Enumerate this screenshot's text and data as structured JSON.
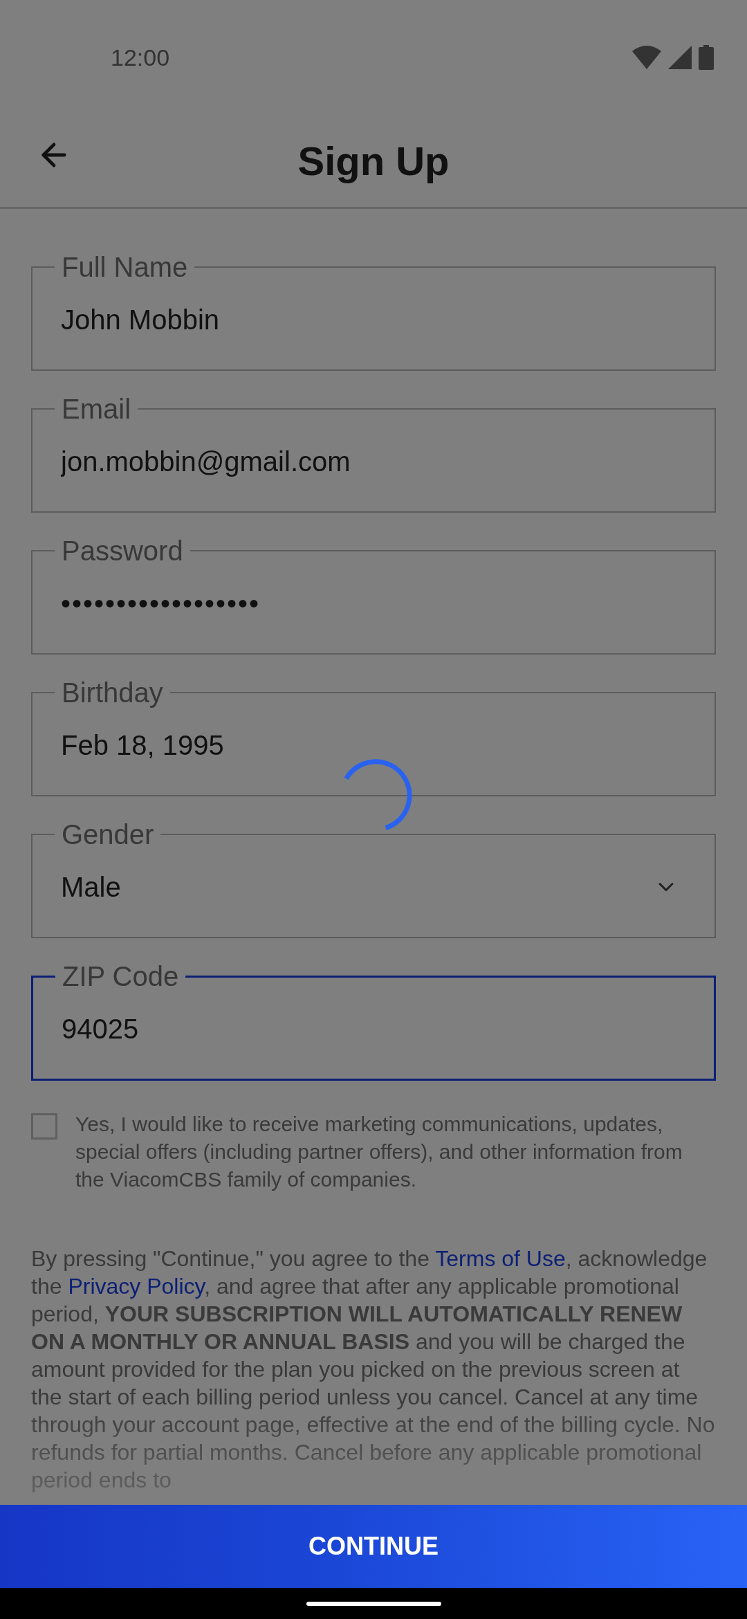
{
  "status_bar": {
    "time": "12:00"
  },
  "app_bar": {
    "title": "Sign Up"
  },
  "fields": [
    {
      "kind": "text",
      "label": "Full Name",
      "value": "John Mobbin",
      "focused": false
    },
    {
      "kind": "text",
      "label": "Email",
      "value": "jon.mobbin@gmail.com",
      "focused": false
    },
    {
      "kind": "password",
      "label": "Password",
      "value": "••••••••••••••••••",
      "focused": false
    },
    {
      "kind": "text",
      "label": "Birthday",
      "value": "Feb 18, 1995",
      "focused": false
    },
    {
      "kind": "dropdown",
      "label": "Gender",
      "value": "Male",
      "focused": false
    },
    {
      "kind": "text",
      "label": "ZIP Code",
      "value": "94025",
      "focused": true
    }
  ],
  "marketing_opt_in": {
    "checked": false,
    "label": "Yes, I would like to receive marketing communications, updates, special offers (including partner offers), and other information from the ViacomCBS family of companies."
  },
  "legal": [
    {
      "kind": "plain",
      "text": "By pressing \"Continue,\" you agree to the "
    },
    {
      "kind": "link",
      "text": "Terms of Use"
    },
    {
      "kind": "plain",
      "text": ", acknowledge the "
    },
    {
      "kind": "link",
      "text": "Privacy Policy"
    },
    {
      "kind": "plain",
      "text": ", and agree that after any applicable promotional period, "
    },
    {
      "kind": "bold",
      "text": "YOUR SUBSCRIPTION WILL AUTOMATICALLY RENEW ON A MONTHLY OR ANNUAL BASIS"
    },
    {
      "kind": "plain",
      "text": " and you will be charged the amount provided for the plan you picked on the previous screen at the start of each billing period unless you cancel. Cancel at any time through your account page, effective at the end of the billing cycle. No refunds for partial months. Cancel before any applicable promotional period ends to"
    }
  ],
  "primary_button": {
    "label": "CONTINUE"
  },
  "loading": true
}
